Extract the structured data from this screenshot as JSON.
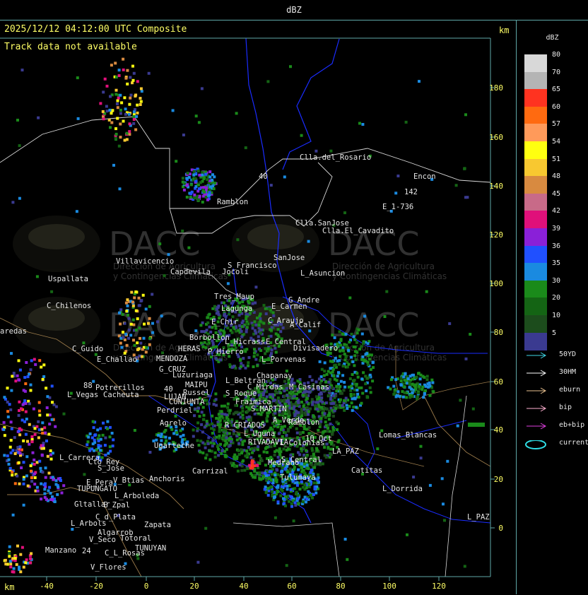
{
  "window": {
    "title": "dBZ"
  },
  "header": {
    "timestamp_line": "2025/12/12 04:12:00 UTC Composite",
    "track_note": "Track data not available",
    "units_top_right": "km",
    "units_bottom_left": "km"
  },
  "axes": {
    "x_ticks": [
      "-40",
      "-20",
      "0",
      "20",
      "40",
      "60",
      "80",
      "100",
      "120"
    ],
    "y_ticks": [
      "180",
      "160",
      "140",
      "120",
      "100",
      "80",
      "60",
      "40",
      "20",
      "0"
    ]
  },
  "colors": {
    "frame": "#5fa8a8",
    "axis_text": "#ffff66",
    "border_blue": "#1a2cff",
    "road": "#9a7a4a",
    "province_line": "#d8d8d8",
    "labels": "#e6e6e6"
  },
  "places": [
    {
      "name": "Clla.del_Rosario"
    },
    {
      "name": "Encon"
    },
    {
      "name": "E_1-736"
    },
    {
      "name": "142"
    },
    {
      "name": "Ramblon"
    },
    {
      "name": "Clla.SanJose"
    },
    {
      "name": "Clla.El_Cavadito"
    },
    {
      "name": "S_Francisco"
    },
    {
      "name": "SanJose"
    },
    {
      "name": "Jocoli"
    },
    {
      "name": "L_Asuncion"
    },
    {
      "name": "Villavicencio"
    },
    {
      "name": "Capdevila"
    },
    {
      "name": "Uspallata"
    },
    {
      "name": "Tres_Maup"
    },
    {
      "name": "G_Andre"
    },
    {
      "name": "Lagunga"
    },
    {
      "name": "E_Carmen"
    },
    {
      "name": "C_Chilenos"
    },
    {
      "name": "E_Chir"
    },
    {
      "name": "C_Araujo"
    },
    {
      "name": "A_Calif"
    },
    {
      "name": "aredas"
    },
    {
      "name": "Borbollon"
    },
    {
      "name": "L_Hicrass"
    },
    {
      "name": "E_Central"
    },
    {
      "name": "Divisadero"
    },
    {
      "name": "C_Guido"
    },
    {
      "name": "HERAS"
    },
    {
      "name": "P_Hierro"
    },
    {
      "name": "L_Porvenas"
    },
    {
      "name": "E_Challao"
    },
    {
      "name": "MENDOZA"
    },
    {
      "name": "G_CRUZ"
    },
    {
      "name": "Chapanay"
    },
    {
      "name": "Luzuriaga"
    },
    {
      "name": "C_Mirdas"
    },
    {
      "name": "M_Casinas"
    },
    {
      "name": "L_Beltran"
    },
    {
      "name": "Potrerillos"
    },
    {
      "name": "Cacheuta"
    },
    {
      "name": "MAIPU"
    },
    {
      "name": "Russel"
    },
    {
      "name": "L_Vegas"
    },
    {
      "name": "LUJAN"
    },
    {
      "name": "S_Roque"
    },
    {
      "name": "CUNIUNTA"
    },
    {
      "name": "Fraimica"
    },
    {
      "name": "Perdriel"
    },
    {
      "name": "S_MARTIN"
    },
    {
      "name": "A_Verde"
    },
    {
      "name": "Ramblon"
    },
    {
      "name": "Agrelo"
    },
    {
      "name": "R_CRIADOS"
    },
    {
      "name": "L_Uguna"
    },
    {
      "name": "Lomas_Blancas"
    },
    {
      "name": "Ugarteche"
    },
    {
      "name": "RIVADAVIA"
    },
    {
      "name": "L_Colonias"
    },
    {
      "name": "10_Oct"
    },
    {
      "name": "L_Carrera"
    },
    {
      "name": "Cto_Rey"
    },
    {
      "name": "S_Jose"
    },
    {
      "name": "Carrizal"
    },
    {
      "name": "Medrano"
    },
    {
      "name": "LA_PAZ"
    },
    {
      "name": "Catitas"
    },
    {
      "name": "S_Central"
    },
    {
      "name": "Tulumaya"
    },
    {
      "name": "E_Pera"
    },
    {
      "name": "V_Btias"
    },
    {
      "name": "Anchoris"
    },
    {
      "name": "TUPUNGATO"
    },
    {
      "name": "L_Dorrida"
    },
    {
      "name": "L_Arboleda"
    },
    {
      "name": "Gltallar"
    },
    {
      "name": "E_Zpal"
    },
    {
      "name": "C_d_Plata"
    },
    {
      "name": "L_PAZ"
    },
    {
      "name": "L_Arbols"
    },
    {
      "name": "Zapata"
    },
    {
      "name": "Algarrob"
    },
    {
      "name": "V_Seco"
    },
    {
      "name": "Totoral"
    },
    {
      "name": "TUNUYAN"
    },
    {
      "name": "Manzano"
    },
    {
      "name": "C_L_Rosas"
    },
    {
      "name": "V_Flores"
    },
    {
      "name": "24"
    },
    {
      "name": "88"
    },
    {
      "name": "40"
    },
    {
      "name": "40"
    }
  ],
  "watermark": {
    "brand": "DACC",
    "line1": "Dirección de Agricultura",
    "line2": "y Contingencias Climáticas"
  },
  "legend": {
    "title": "dBZ",
    "entries": [
      {
        "value": "80",
        "color": "#d8d8d8"
      },
      {
        "value": "70",
        "color": "#b4b4b4"
      },
      {
        "value": "65",
        "color": "#ff3320"
      },
      {
        "value": "60",
        "color": "#ff6a10"
      },
      {
        "value": "57",
        "color": "#ff9a5a"
      },
      {
        "value": "54",
        "color": "#ffff10"
      },
      {
        "value": "51",
        "color": "#f8c830"
      },
      {
        "value": "48",
        "color": "#d88a40"
      },
      {
        "value": "45",
        "color": "#c86a88"
      },
      {
        "value": "42",
        "color": "#e0107a"
      },
      {
        "value": "39",
        "color": "#8a20d8"
      },
      {
        "value": "36",
        "color": "#2050ff"
      },
      {
        "value": "35",
        "color": "#1a8ae0"
      },
      {
        "value": "30",
        "color": "#1a8a1a"
      },
      {
        "value": "20",
        "color": "#146414"
      },
      {
        "value": "10",
        "color": "#1c4c1c"
      },
      {
        "value": "5",
        "color": "#3a3a90"
      }
    ],
    "tracks": [
      {
        "label": "50YD",
        "color": "#40d8e8"
      },
      {
        "label": "30HM",
        "color": "#ffffff"
      },
      {
        "label": "eburn",
        "color": "#e8c090"
      },
      {
        "label": "bip",
        "color": "#ffb0d0"
      },
      {
        "label": "eb+bip",
        "color": "#e040e0"
      },
      {
        "label": "current",
        "color": "#30e0e8"
      }
    ]
  }
}
